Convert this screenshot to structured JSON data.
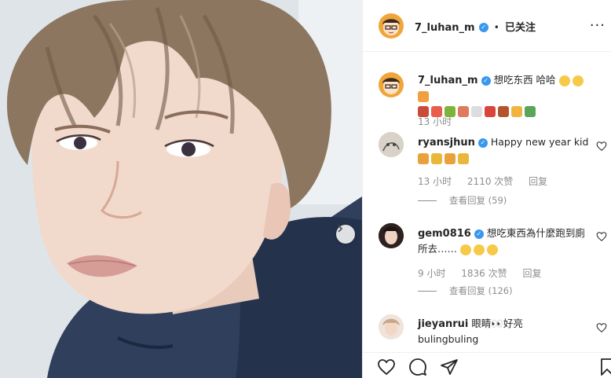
{
  "header": {
    "username": "7_luhan_m",
    "separator": "•",
    "follow_label": "已关注",
    "more_label": "···"
  },
  "caption": {
    "username": "7_luhan_m",
    "text": "想吃东西 哈哈",
    "time": "13 小时"
  },
  "comments": [
    {
      "username": "ryansjhun",
      "text": "Happy new year kid",
      "time": "13 小时",
      "likes": "2110 次赞",
      "reply_label": "回复",
      "view_replies": "查看回复 (59)"
    },
    {
      "username": "gem0816",
      "text": "想吃東西為什麼跑到廁所去……",
      "time": "9 小时",
      "likes": "1836 次赞",
      "reply_label": "回复",
      "view_replies": "查看回复 (126)"
    },
    {
      "username": "jieyanrui",
      "text": "眼睛👀好亮",
      "text2": "bulingbuling"
    }
  ],
  "icons": {
    "verified": "verified-badge-icon",
    "next": "chevron-right-icon",
    "like": "heart-icon",
    "comment": "comment-icon",
    "share": "paper-plane-icon",
    "save": "bookmark-icon"
  },
  "colors": {
    "verified_blue": "#3897f0",
    "muted_text": "#8e8e8e",
    "divider": "#efefef"
  }
}
